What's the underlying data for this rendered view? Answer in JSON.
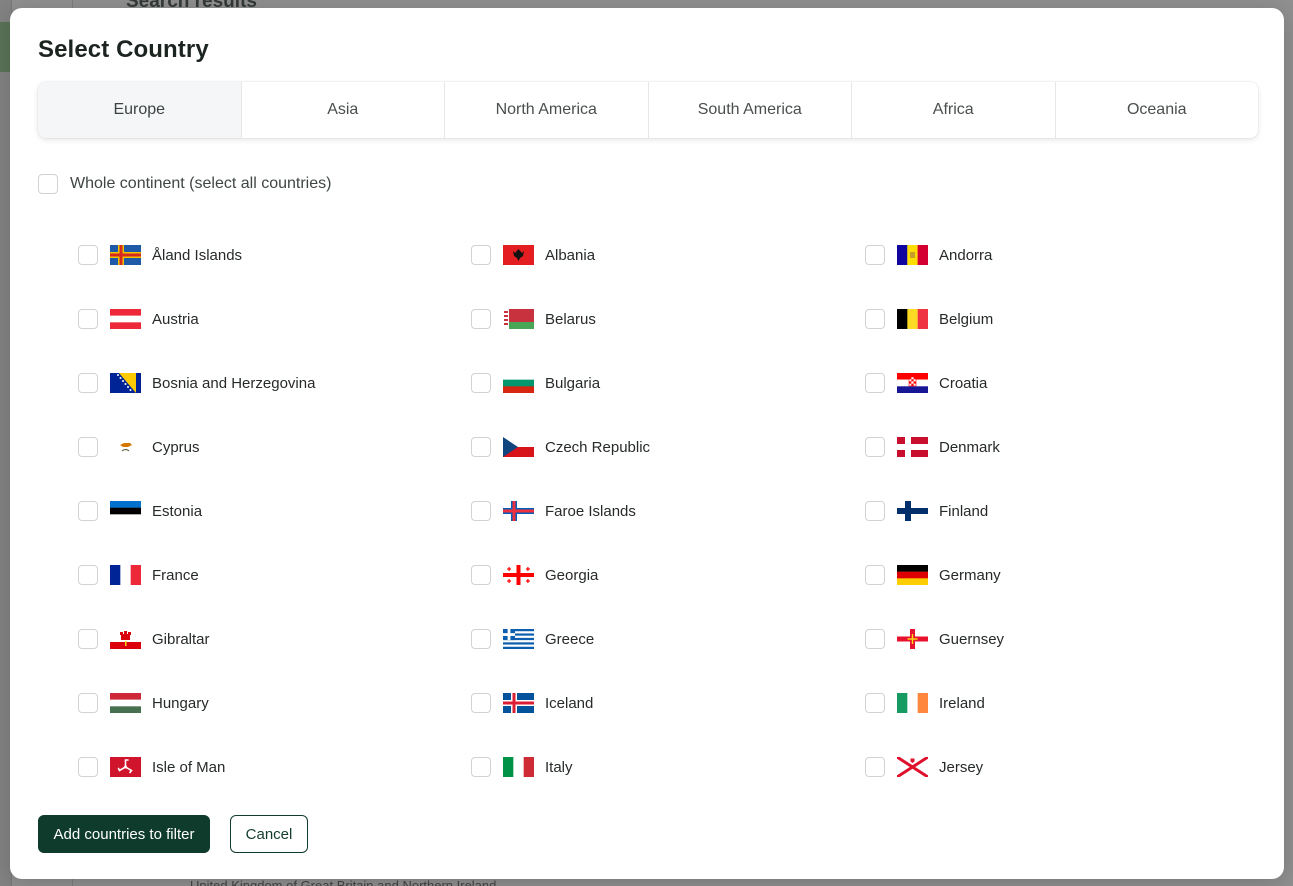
{
  "background": {
    "heading": "Search results",
    "footer_text": "United Kingdom of Great Britain and Northern Ireland"
  },
  "modal": {
    "title": "Select Country",
    "tabs": [
      "Europe",
      "Asia",
      "North America",
      "South America",
      "Africa",
      "Oceania"
    ],
    "active_tab": "Europe",
    "whole_continent_label": "Whole continent (select all countries)",
    "countries": [
      {
        "name": "Åland Islands",
        "flag": "aland"
      },
      {
        "name": "Albania",
        "flag": "albania"
      },
      {
        "name": "Andorra",
        "flag": "andorra"
      },
      {
        "name": "Austria",
        "flag": "austria"
      },
      {
        "name": "Belarus",
        "flag": "belarus"
      },
      {
        "name": "Belgium",
        "flag": "belgium"
      },
      {
        "name": "Bosnia and Herzegovina",
        "flag": "bosnia"
      },
      {
        "name": "Bulgaria",
        "flag": "bulgaria"
      },
      {
        "name": "Croatia",
        "flag": "croatia"
      },
      {
        "name": "Cyprus",
        "flag": "cyprus"
      },
      {
        "name": "Czech Republic",
        "flag": "czech"
      },
      {
        "name": "Denmark",
        "flag": "denmark"
      },
      {
        "name": "Estonia",
        "flag": "estonia"
      },
      {
        "name": "Faroe Islands",
        "flag": "faroe"
      },
      {
        "name": "Finland",
        "flag": "finland"
      },
      {
        "name": "France",
        "flag": "france"
      },
      {
        "name": "Georgia",
        "flag": "georgia"
      },
      {
        "name": "Germany",
        "flag": "germany"
      },
      {
        "name": "Gibraltar",
        "flag": "gibraltar"
      },
      {
        "name": "Greece",
        "flag": "greece"
      },
      {
        "name": "Guernsey",
        "flag": "guernsey"
      },
      {
        "name": "Hungary",
        "flag": "hungary"
      },
      {
        "name": "Iceland",
        "flag": "iceland"
      },
      {
        "name": "Ireland",
        "flag": "ireland"
      },
      {
        "name": "Isle of Man",
        "flag": "isleofman"
      },
      {
        "name": "Italy",
        "flag": "italy"
      },
      {
        "name": "Jersey",
        "flag": "jersey"
      }
    ],
    "buttons": {
      "add": "Add countries to filter",
      "cancel": "Cancel"
    }
  },
  "colors": {
    "primary": "#0f3b2c",
    "active_tab_bg": "#f5f6f7"
  }
}
